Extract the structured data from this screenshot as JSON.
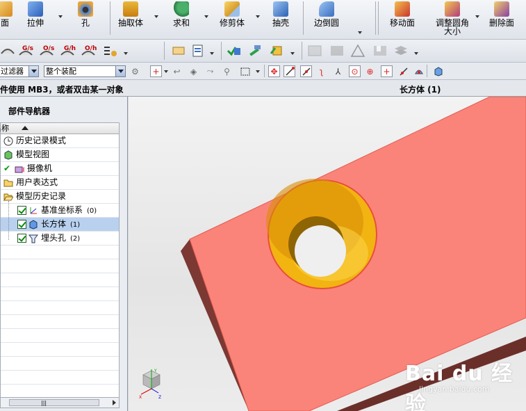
{
  "toolbar_main": {
    "items": [
      {
        "label": "面",
        "icon": "face-icon"
      },
      {
        "label": "拉伸",
        "icon": "extrude-icon"
      },
      {
        "label": "孔",
        "icon": "hole-icon"
      },
      {
        "label": "抽取体",
        "icon": "extract-body-icon"
      },
      {
        "label": "求和",
        "icon": "unite-icon"
      },
      {
        "label": "修剪体",
        "icon": "trim-body-icon"
      },
      {
        "label": "抽壳",
        "icon": "shell-icon"
      },
      {
        "label": "边倒圆",
        "icon": "edge-blend-icon"
      },
      {
        "label": "移动面",
        "icon": "move-face-icon"
      },
      {
        "label": "调整圆角",
        "label2": "大小",
        "icon": "resize-blend-icon"
      },
      {
        "label": "删除面",
        "icon": "delete-face-icon"
      }
    ]
  },
  "toolbar_secondary": {
    "gdt_labels": [
      "G/s",
      "O/s",
      "G/h",
      "O/h"
    ]
  },
  "selection_bar": {
    "filter_value": "过滤器",
    "scope_value": "整个装配"
  },
  "status": {
    "message": "件使用 MB3，或者双击某一对象",
    "selected": "长方体 (1)"
  },
  "navigator": {
    "title": "部件导航器",
    "column_header": "名称",
    "rows": [
      {
        "label": "历史记录模式",
        "icon": "clock-icon"
      },
      {
        "label": "模型视图",
        "icon": "model-views-icon"
      },
      {
        "label": "摄像机",
        "icon": "camera-icon"
      },
      {
        "label": "用户表达式",
        "icon": "folder-icon"
      },
      {
        "label": "模型历史记录",
        "icon": "folder-open-icon"
      },
      {
        "label": "基准坐标系",
        "num": "(0)",
        "icon": "datum-csys-icon"
      },
      {
        "label": "长方体",
        "num": "(1)",
        "icon": "block-icon"
      },
      {
        "label": "埋头孔",
        "num": "(2)",
        "icon": "countersink-icon"
      }
    ]
  },
  "viewport": {
    "watermark": "Bai du 经验",
    "watermark_url": "jingyan.baidu.com",
    "colors": {
      "block_top": "#fa8479",
      "block_side": "#7c3833",
      "hole_taper": "#f2b410"
    }
  }
}
